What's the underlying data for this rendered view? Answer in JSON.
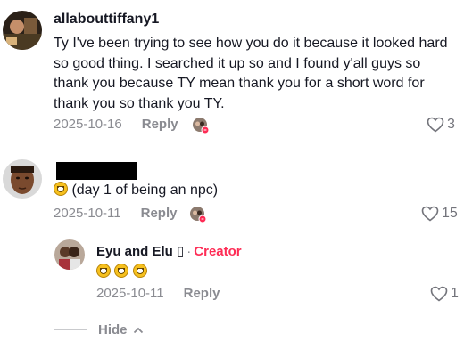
{
  "comments": [
    {
      "username": "allabouttiffany1",
      "text_lines": [
        "Ty I've been trying to see how you do it because it looked hard",
        "so good thing. I searched it up so and I found y'all guys so",
        "thank you because TY mean thank you for a short word for",
        "thank you so thank you TY."
      ],
      "date": "2025-10-16",
      "reply_label": "Reply",
      "likes": "3"
    },
    {
      "username": "",
      "text": "(day 1 of being an npc)",
      "emoji": "grinning-face",
      "date": "2025-10-11",
      "reply_label": "Reply",
      "likes": "15"
    }
  ],
  "reply": {
    "username": "Eyu and Elu ▯",
    "separator": "·",
    "badge": "Creator",
    "emojis": [
      "grinning-face",
      "grinning-face",
      "grinning-face"
    ],
    "date": "2025-10-11",
    "reply_label": "Reply",
    "likes": "1"
  },
  "hide": {
    "label": "Hide",
    "icon": "chevron-up-icon"
  },
  "colors": {
    "accent": "#fe2c55",
    "muted": "#8a8b91",
    "text": "#161823"
  }
}
